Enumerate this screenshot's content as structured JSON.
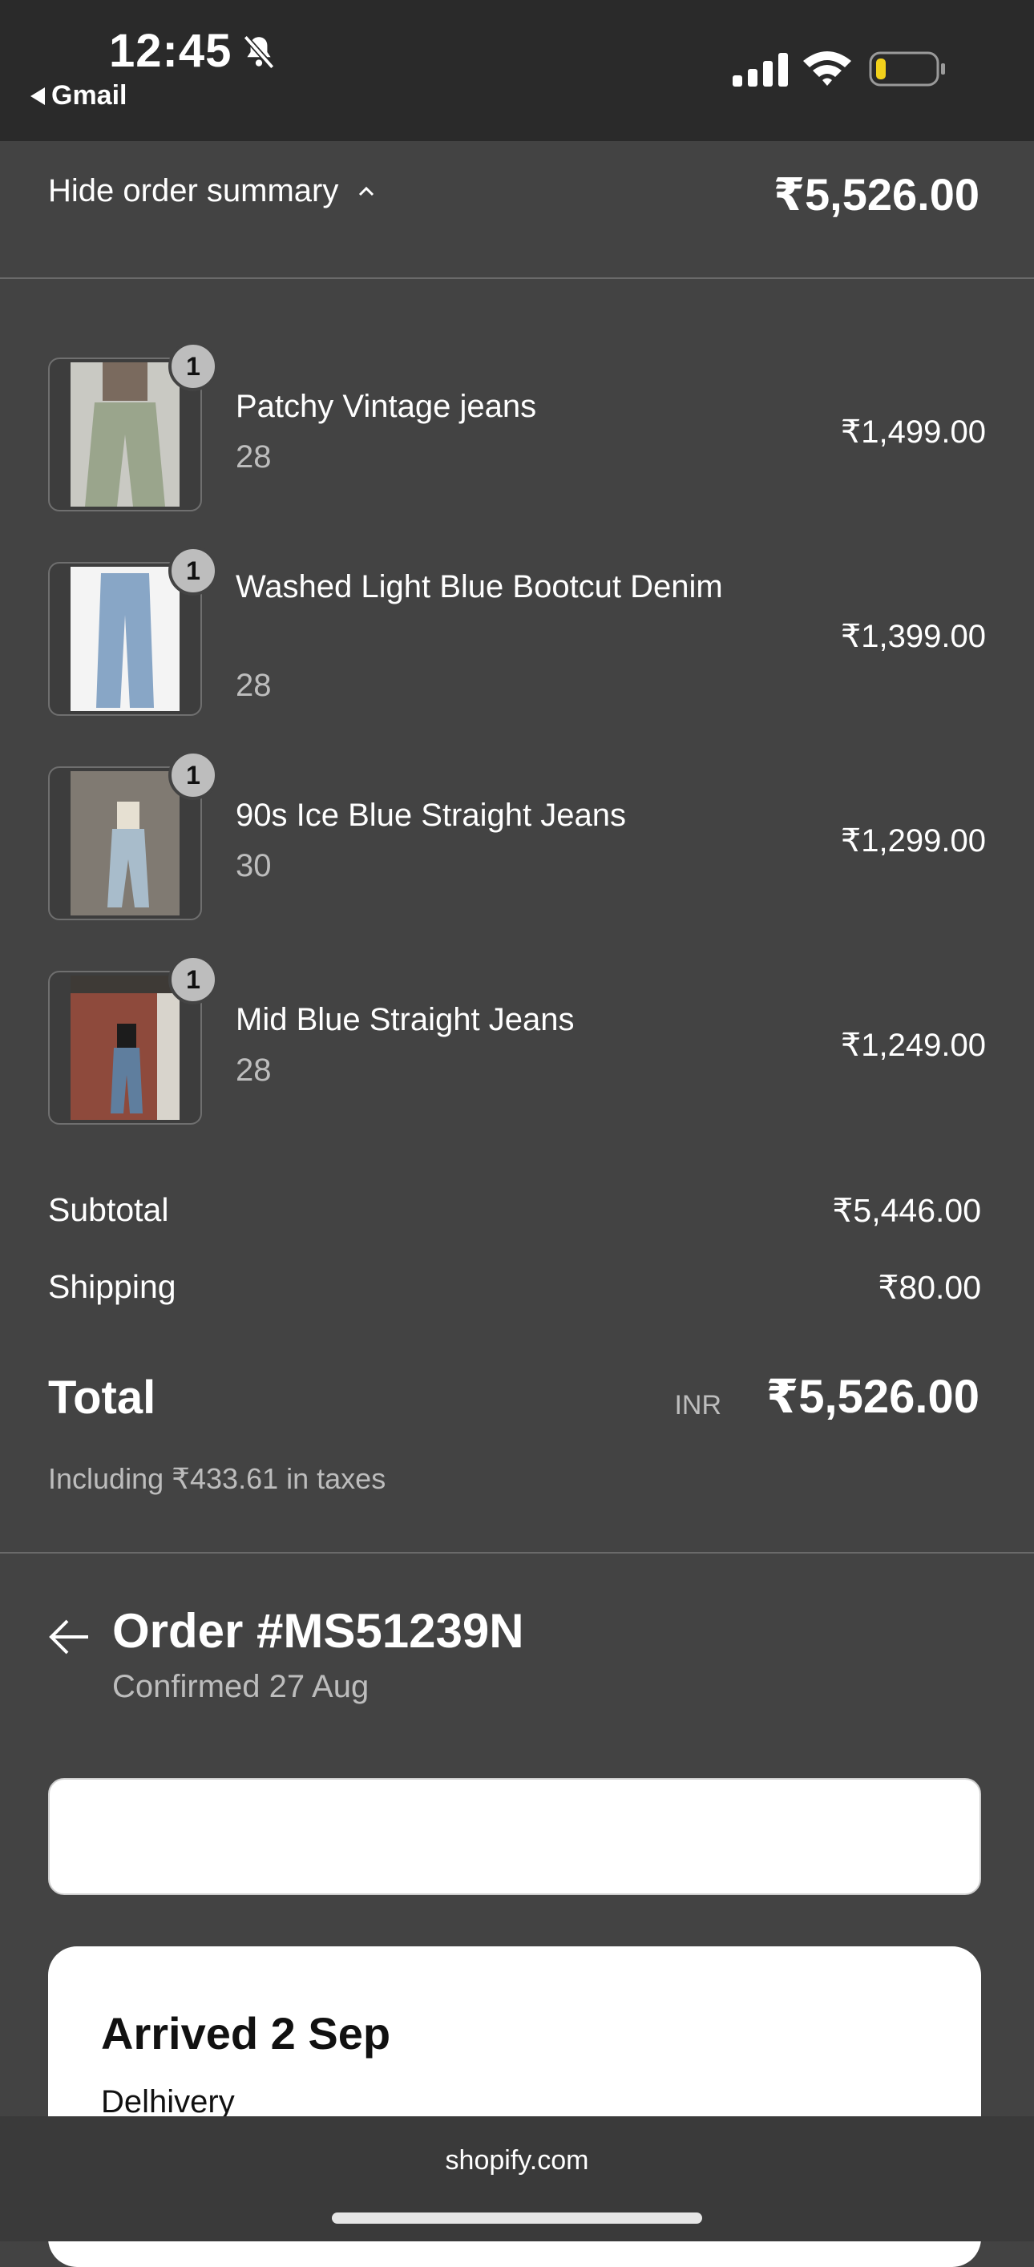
{
  "status_bar": {
    "time": "12:45",
    "back_app": "Gmail"
  },
  "summary": {
    "toggle_label": "Hide order summary",
    "total": "₹5,526.00"
  },
  "items": [
    {
      "qty": "1",
      "name": "Patchy Vintage jeans",
      "variant": "28",
      "price": "₹1,499.00"
    },
    {
      "qty": "1",
      "name": "Washed Light Blue Bootcut Denim",
      "variant": "28",
      "price": "₹1,399.00"
    },
    {
      "qty": "1",
      "name": "90s Ice Blue Straight Jeans",
      "variant": "30",
      "price": "₹1,299.00"
    },
    {
      "qty": "1",
      "name": "Mid Blue Straight Jeans",
      "variant": "28",
      "price": "₹1,249.00"
    }
  ],
  "totals": {
    "subtotal_label": "Subtotal",
    "subtotal": "₹5,446.00",
    "shipping_label": "Shipping",
    "shipping": "₹80.00",
    "total_label": "Total",
    "currency": "INR",
    "total": "₹5,526.00",
    "taxes_note": "Including ₹433.61 in taxes"
  },
  "order": {
    "title": "Order #MS51239N",
    "confirmed": "Confirmed 27 Aug"
  },
  "delivery": {
    "status": "Arrived 2 Sep",
    "carrier": "Delhivery"
  },
  "browser": {
    "domain": "shopify.com"
  }
}
